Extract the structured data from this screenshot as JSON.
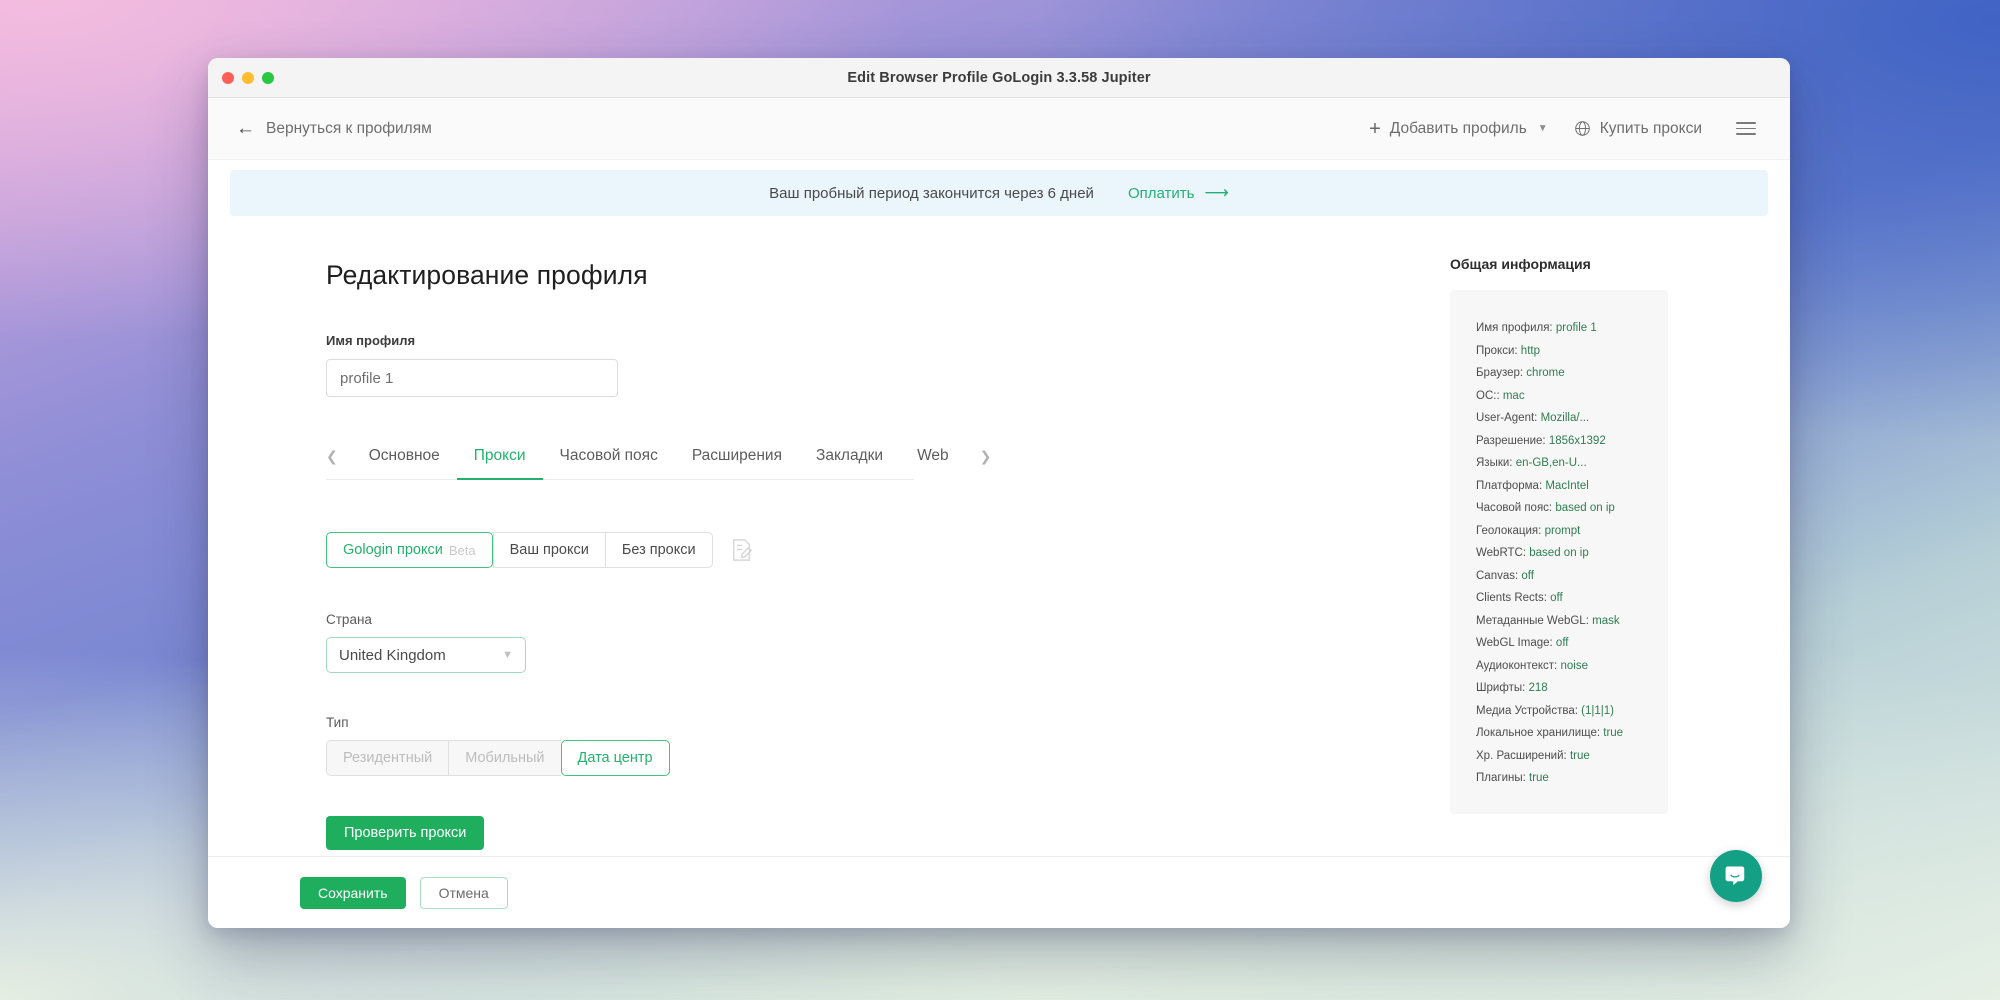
{
  "window": {
    "title": "Edit Browser Profile GoLogin 3.3.58 Jupiter",
    "traffic_lights": [
      "close",
      "minimize",
      "zoom"
    ]
  },
  "topnav": {
    "back_label": "Вернуться к профилям",
    "back_icon": "arrow-left-icon",
    "add_profile_label": "Добавить профиль",
    "add_profile_icon": "plus-icon",
    "add_profile_chevron": "chevron-down-icon",
    "buy_proxy_label": "Купить прокси",
    "buy_proxy_icon": "globe-icon",
    "menu_icon": "hamburger-menu-icon"
  },
  "banner": {
    "text": "Ваш пробный период закончится через 6 дней",
    "action_label": "Оплатить",
    "action_icon": "arrow-right-icon",
    "background": "#eaf6fb",
    "action_color": "#27ae75"
  },
  "main": {
    "page_title": "Редактирование профиля",
    "profile_name_label": "Имя профиля",
    "profile_name_value": "profile 1",
    "profile_name_placeholder": "profile 1",
    "tabs": {
      "prev_icon": "chevron-left-icon",
      "next_icon": "chevron-right-icon",
      "items": [
        {
          "label": "Основное",
          "active": false
        },
        {
          "label": "Прокси",
          "active": true
        },
        {
          "label": "Часовой пояс",
          "active": false
        },
        {
          "label": "Расширения",
          "active": false
        },
        {
          "label": "Закладки",
          "active": false
        },
        {
          "label": "Web",
          "active": false
        }
      ]
    },
    "proxy_source": {
      "options": [
        {
          "label": "Gologin прокси",
          "badge": "Beta",
          "state": "active"
        },
        {
          "label": "Ваш прокси",
          "badge": "",
          "state": "normal"
        },
        {
          "label": "Без прокси",
          "badge": "",
          "state": "normal"
        }
      ],
      "edit_icon": "edit-note-icon"
    },
    "country": {
      "label": "Страна",
      "value": "United Kingdom",
      "chevron_icon": "chevron-down-icon"
    },
    "proxy_type": {
      "label": "Тип",
      "options": [
        {
          "label": "Резидентный",
          "state": "disabled"
        },
        {
          "label": "Мобильный",
          "state": "disabled"
        },
        {
          "label": "Дата центр",
          "state": "active"
        }
      ]
    },
    "check_proxy_label": "Проверить прокси"
  },
  "sidebar": {
    "title": "Общая информация",
    "rows": [
      {
        "key": "Имя профиля:",
        "value": "profile 1"
      },
      {
        "key": "Прокси:",
        "value": "http"
      },
      {
        "key": "Браузер:",
        "value": "chrome"
      },
      {
        "key": "ОС::",
        "value": "mac"
      },
      {
        "key": "User-Agent:",
        "value": "Mozilla/..."
      },
      {
        "key": "Разрешение:",
        "value": "1856x1392"
      },
      {
        "key": "Языки:",
        "value": "en-GB,en-U..."
      },
      {
        "key": "Платформа:",
        "value": "MacIntel"
      },
      {
        "key": "Часовой пояс:",
        "value": "based on ip"
      },
      {
        "key": "Геолокация:",
        "value": "prompt"
      },
      {
        "key": "WebRTC:",
        "value": "based on ip"
      },
      {
        "key": "Canvas:",
        "value": "off"
      },
      {
        "key": "Clients Rects:",
        "value": "off"
      },
      {
        "key": "Метаданные WebGL:",
        "value": "mask"
      },
      {
        "key": "WebGL Image:",
        "value": "off"
      },
      {
        "key": "Аудиоконтекст:",
        "value": "noise"
      },
      {
        "key": "Шрифты:",
        "value": "218"
      },
      {
        "key": "Медиа Устройства:",
        "value": "(1|1|1)"
      },
      {
        "key": "Локальное хранилище:",
        "value": "true"
      },
      {
        "key": "Хр. Расширений:",
        "value": "true"
      },
      {
        "key": "Плагины:",
        "value": "true"
      }
    ]
  },
  "footer": {
    "save_label": "Сохранить",
    "cancel_label": "Отмена"
  },
  "chat": {
    "icon": "intercom-chat-icon",
    "color": "#14a085"
  },
  "theme": {
    "accent_green": "#1fae5e",
    "accent_green_text": "#23b26d",
    "banner_blue": "#eaf6fb",
    "info_value_green": "#2f7d52"
  }
}
